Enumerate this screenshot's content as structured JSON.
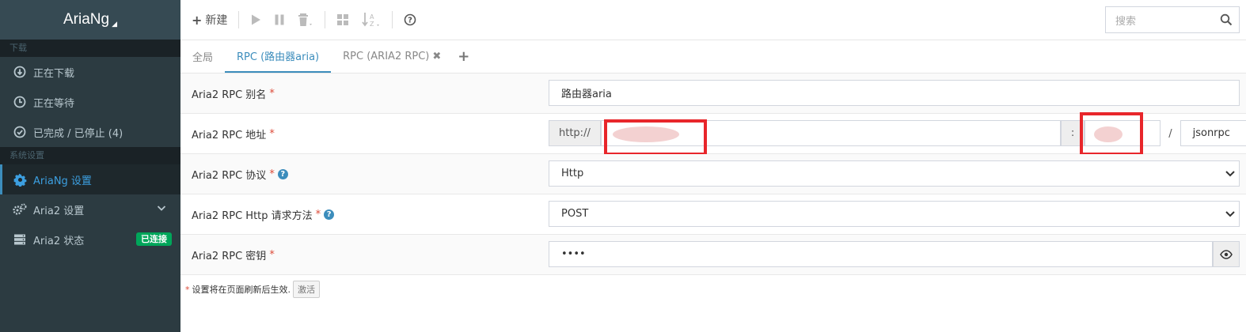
{
  "sidebar": {
    "brand": "AriaNg",
    "section_download": "下载",
    "section_settings": "系统设置",
    "items": [
      {
        "label": "正在下载",
        "icon": "download-circle-icon"
      },
      {
        "label": "正在等待",
        "icon": "clock-icon"
      },
      {
        "label": "已完成 / 已停止 (4)",
        "icon": "check-circle-icon"
      },
      {
        "label": "AriaNg 设置",
        "icon": "gear-icon"
      },
      {
        "label": "Aria2 设置",
        "icon": "gears-icon"
      },
      {
        "label": "Aria2 状态",
        "icon": "server-icon",
        "badge": "已连接"
      }
    ]
  },
  "toolbar": {
    "new_label": "新建",
    "search_placeholder": "搜索"
  },
  "tabs": [
    {
      "label": "全局"
    },
    {
      "label": "RPC (路由器aria)"
    },
    {
      "label": "RPC (ARIA2 RPC)"
    }
  ],
  "form": {
    "alias_label": "Aria2 RPC 别名",
    "alias_value": "路由器aria",
    "address_label": "Aria2 RPC 地址",
    "address_protocol": "http://",
    "address_colon": ":",
    "address_slash": "/",
    "address_path": "jsonrpc",
    "protocol_label": "Aria2 RPC 协议",
    "protocol_value": "Http",
    "method_label": "Aria2 RPC Http 请求方法",
    "method_value": "POST",
    "secret_label": "Aria2 RPC 密钥",
    "secret_value": "••••",
    "required_mark": "*"
  },
  "footer": {
    "note": "设置将在页面刷新后生效.",
    "reload_label": "激活"
  },
  "colors": {
    "sidebar_bg": "#2c3b41",
    "accent": "#3c8dbc",
    "badge_green": "#00a65a",
    "required_red": "#dd4b39",
    "redact_box": "#e8262b"
  }
}
